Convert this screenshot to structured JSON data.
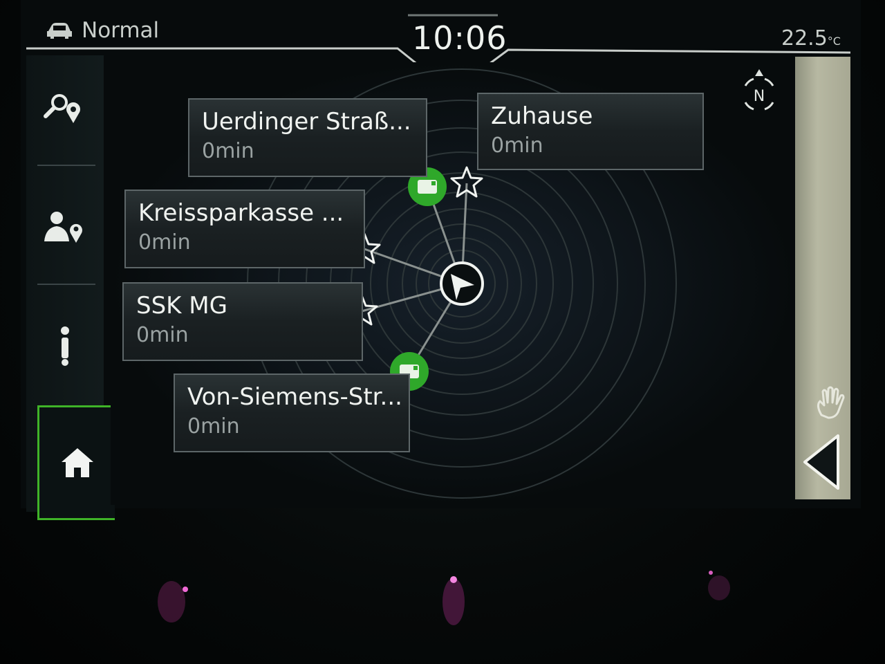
{
  "status_bar": {
    "drive_mode": "Normal",
    "clock": "10:06",
    "temperature": "22.5",
    "temperature_unit": "°C"
  },
  "sidebar": {
    "items": [
      {
        "icon": "search-destination-icon"
      },
      {
        "icon": "contacts-destination-icon"
      },
      {
        "icon": "route-info-icon"
      },
      {
        "icon": "home-icon",
        "active": true
      }
    ]
  },
  "destinations": [
    {
      "name": "Uerdinger Straß...",
      "time": "0min",
      "marker": "green-card"
    },
    {
      "name": "Zuhause",
      "time": "0min",
      "marker": "star"
    },
    {
      "name": "Kreissparkasse ...",
      "time": "0min",
      "marker": "star"
    },
    {
      "name": "SSK MG",
      "time": "0min",
      "marker": "star"
    },
    {
      "name": "Von-Siemens-Str...",
      "time": "0min",
      "marker": "green-card"
    }
  ],
  "compass": {
    "label": "N"
  },
  "colors": {
    "accent": "#3fb428",
    "panel": "#1a2022",
    "text": "#f0f3f0",
    "subtext": "#9aa2a2"
  }
}
